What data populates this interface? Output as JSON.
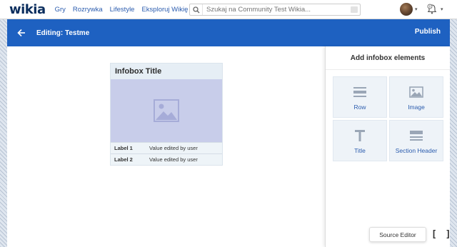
{
  "global_nav": {
    "logo": "wikia",
    "links": [
      "Gry",
      "Rozrywka",
      "Lifestyle",
      "Eksploruj Wikię"
    ],
    "explore_caret": "▾",
    "search_placeholder": "Szukaj na Community Test Wikia...",
    "icons": [
      "search-icon",
      "avatar",
      "bell-icon",
      "notification-count"
    ]
  },
  "editor": {
    "title": "Editing: Testme",
    "publish_label": "Publish",
    "accent_color": "#1e61c1"
  },
  "infobox": {
    "title": "Infobox Title",
    "rows": [
      {
        "label": "Label 1",
        "value": "Value edited by user"
      },
      {
        "label": "Label 2",
        "value": "Value edited by user"
      }
    ]
  },
  "panel": {
    "title": "Add infobox elements",
    "tiles": [
      {
        "label": "Row",
        "icon": "row-icon"
      },
      {
        "label": "Image",
        "icon": "image-icon"
      },
      {
        "label": "Title",
        "icon": "title-icon"
      },
      {
        "label": "Section Header",
        "icon": "section-header-icon"
      }
    ]
  },
  "source_editor": {
    "tooltip": "Source Editor",
    "icon_glyph": "[ ]"
  },
  "notifications": {
    "count": "0"
  }
}
